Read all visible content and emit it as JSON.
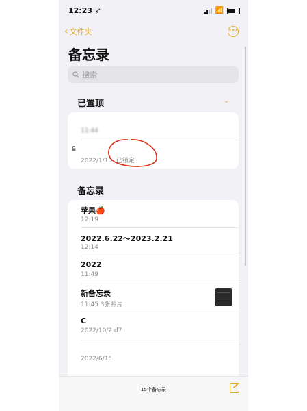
{
  "status": {
    "time": "12:23"
  },
  "nav": {
    "back_label": "文件夹"
  },
  "title": "备忘录",
  "search": {
    "placeholder": "搜索"
  },
  "pinned": {
    "header": "已置顶",
    "notes": [
      {
        "time": "11:44"
      },
      {
        "date": "2022/1/10",
        "status": "已锁定"
      }
    ]
  },
  "notes_section": {
    "header": "备忘录"
  },
  "notes": [
    {
      "title": "苹果🍎",
      "meta": "12:19"
    },
    {
      "title": "2022.6.22～2023.2.21",
      "meta": "12:14"
    },
    {
      "title": "2022",
      "meta": "11:49"
    },
    {
      "title": "新备忘录",
      "meta": "11:45  3张照片"
    },
    {
      "title": "C",
      "meta": "2022/10/2  d7"
    },
    {
      "title": "",
      "meta": "2022/6/15"
    }
  ],
  "footer": {
    "count": "15个备忘录"
  },
  "colors": {
    "accent": "#e3a92b",
    "annotation": "#d8301a"
  }
}
